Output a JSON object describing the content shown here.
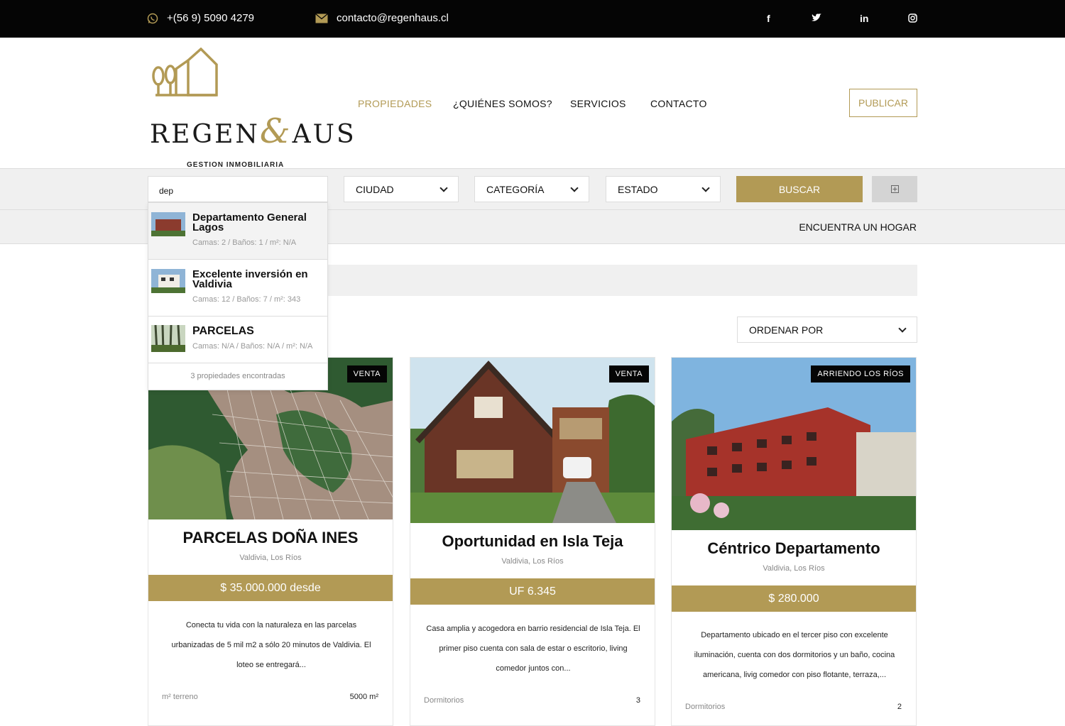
{
  "topbar": {
    "phone": "+(56 9) 5090 4279",
    "email": "contacto@regenhaus.cl",
    "social": [
      "f",
      "twitter",
      "in",
      "instagram"
    ]
  },
  "logo": {
    "word_left": "REGEN",
    "word_mid": "&",
    "word_right": "AUS",
    "tagline": "GESTION INMOBILIARIA"
  },
  "nav": {
    "items": [
      "PROPIEDADES",
      "¿QUIÉNES SOMOS?",
      "SERVICIOS",
      "CONTACTO"
    ],
    "publish": "PUBLICAR"
  },
  "search": {
    "query": "dep",
    "city": "CIUDAD",
    "category": "CATEGORÍA",
    "status": "ESTADO",
    "button": "BUSCAR"
  },
  "crumb": {
    "right": "ENCUENTRA UN HOGAR"
  },
  "order": {
    "label": "ORDENAR POR"
  },
  "dropdown": {
    "results": [
      {
        "title": "Departamento General Lagos",
        "meta": "Camas: 2 /  Baños: 1 /  m²: N/A"
      },
      {
        "title": "Excelente inversión en Valdivia",
        "meta": "Camas: 12 /  Baños: 7 /  m²: 343"
      },
      {
        "title": "PARCELAS",
        "meta": "Camas: N/A /  Baños: N/A /  m²: N/A"
      }
    ],
    "count": "3 propiedades encontradas"
  },
  "cards": [
    {
      "badge": "VENTA",
      "title": "PARCELAS DOÑA INES",
      "location": "Valdivia, Los Ríos",
      "price": "$ 35.000.000 desde",
      "description": "Conecta tu vida con la naturaleza en las parcelas urbanizadas de 5 mil m2 a sólo 20 minutos de Valdivia. El loteo se entregará...",
      "feature_label": "m² terreno",
      "feature_value": "5000 m²"
    },
    {
      "badge": "VENTA",
      "title": "Oportunidad en Isla Teja",
      "location": "Valdivia, Los Ríos",
      "price": "UF 6.345",
      "description": "Casa amplia y acogedora en barrio residencial de Isla Teja. El primer piso cuenta con sala de estar o escritorio, living comedor juntos con...",
      "feature_label": "Dormitorios",
      "feature_value": "3"
    },
    {
      "badge": "ARRIENDO LOS RÍOS",
      "title": "Céntrico Departamento",
      "location": "Valdivia, Los Ríos",
      "price": "$ 280.000",
      "description": "Departamento ubicado en el tercer piso con excelente iluminación, cuenta con  dos dormitorios y un baño, cocina americana, livig comedor con piso flotante, terraza,...",
      "feature_label": "Dormitorios",
      "feature_value": "2"
    }
  ],
  "colors": {
    "gold": "#b29a55",
    "black": "#050505",
    "light_gray": "#f0f0f0"
  }
}
